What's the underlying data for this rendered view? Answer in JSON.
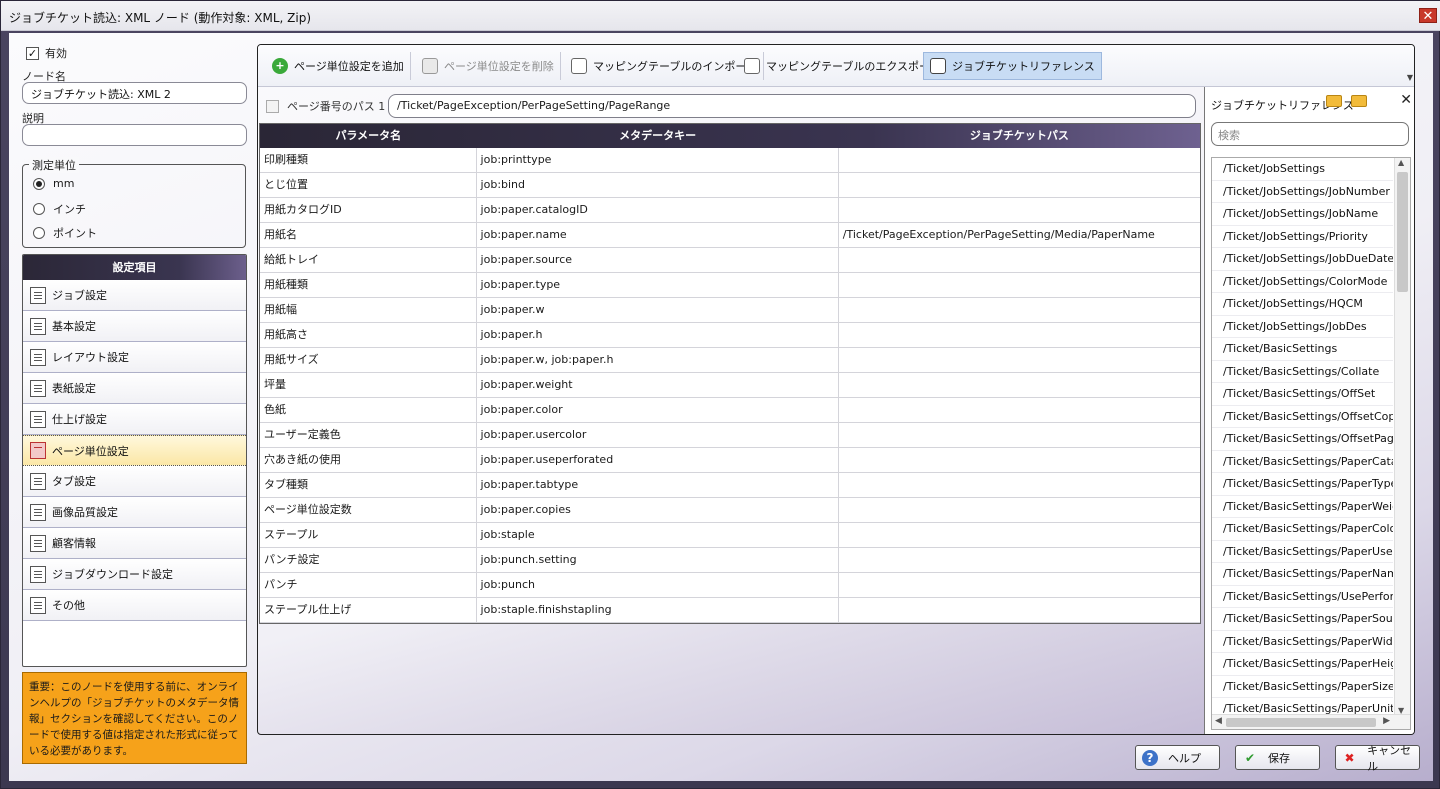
{
  "window": {
    "title": "ジョブチケット読込: XML ノード (動作対象: XML, Zip)",
    "close": "✕"
  },
  "left": {
    "enabled_label": "有効",
    "enabled_mark": "✓",
    "node_name_label": "ノード名",
    "node_name_value": "ジョブチケット読込: XML 2",
    "description_label": "説明",
    "description_value": "",
    "unit_legend": "測定単位",
    "units": [
      "mm",
      "インチ",
      "ポイント"
    ],
    "settings_header": "設定項目",
    "settings": [
      "ジョブ設定",
      "基本設定",
      "レイアウト設定",
      "表紙設定",
      "仕上げ設定",
      "ページ単位設定",
      "タブ設定",
      "画像品質設定",
      "顧客情報",
      "ジョブダウンロード設定",
      "その他"
    ],
    "notice": "重要：このノードを使用する前に、オンラインヘルプの「ジョブチケットのメタデータ情報」セクションを確認してください。このノードで使用する値は指定された形式に従っている必要があります。"
  },
  "toolbar": {
    "add": "ページ単位設定を追加",
    "delete": "ページ単位設定を削除",
    "import": "マッピングテーブルのインポート",
    "export": "マッピングテーブルのエクスポート",
    "reference": "ジョブチケットリファレンス"
  },
  "path": {
    "label": "ページ番号のパス 1",
    "value": "/Ticket/PageException/PerPageSetting/PageRange"
  },
  "grid": {
    "headers": [
      "パラメータ名",
      "メタデータキー",
      "ジョブチケットパス"
    ],
    "rows": [
      [
        "印刷種類",
        "job:printtype",
        ""
      ],
      [
        "とじ位置",
        "job:bind",
        ""
      ],
      [
        "用紙カタログID",
        "job:paper.catalogID",
        ""
      ],
      [
        "用紙名",
        "job:paper.name",
        "/Ticket/PageException/PerPageSetting/Media/PaperName"
      ],
      [
        "給紙トレイ",
        "job:paper.source",
        ""
      ],
      [
        "用紙種類",
        "job:paper.type",
        ""
      ],
      [
        "用紙幅",
        "job:paper.w",
        ""
      ],
      [
        "用紙高さ",
        "job:paper.h",
        ""
      ],
      [
        "用紙サイズ",
        "job:paper.w, job:paper.h",
        ""
      ],
      [
        "坪量",
        "job:paper.weight",
        ""
      ],
      [
        "色紙",
        "job:paper.color",
        ""
      ],
      [
        "ユーザー定義色",
        "job:paper.usercolor",
        ""
      ],
      [
        "穴あき紙の使用",
        "job:paper.useperforated",
        ""
      ],
      [
        "タブ種類",
        "job:paper.tabtype",
        ""
      ],
      [
        "ページ単位設定数",
        "job:paper.copies",
        ""
      ],
      [
        "ステープル",
        "job:staple",
        ""
      ],
      [
        "パンチ設定",
        "job:punch.setting",
        ""
      ],
      [
        "パンチ",
        "job:punch",
        ""
      ],
      [
        "ステープル仕上げ",
        "job:staple.finishstapling",
        ""
      ]
    ]
  },
  "reference": {
    "title": "ジョブチケットリファレンス",
    "close": "✕",
    "search_placeholder": "検索",
    "items": [
      "/Ticket/JobSettings",
      "/Ticket/JobSettings/JobNumber",
      "/Ticket/JobSettings/JobName",
      "/Ticket/JobSettings/Priority",
      "/Ticket/JobSettings/JobDueDate",
      "/Ticket/JobSettings/ColorMode",
      "/Ticket/JobSettings/HQCM",
      "/Ticket/JobSettings/JobDes",
      "/Ticket/BasicSettings",
      "/Ticket/BasicSettings/Collate",
      "/Ticket/BasicSettings/OffSet",
      "/Ticket/BasicSettings/OffsetCopies",
      "/Ticket/BasicSettings/OffsetPages",
      "/Ticket/BasicSettings/PaperCatalog",
      "/Ticket/BasicSettings/PaperType",
      "/Ticket/BasicSettings/PaperWeight",
      "/Ticket/BasicSettings/PaperColor",
      "/Ticket/BasicSettings/PaperUserColor",
      "/Ticket/BasicSettings/PaperName",
      "/Ticket/BasicSettings/UsePerforated",
      "/Ticket/BasicSettings/PaperSource",
      "/Ticket/BasicSettings/PaperWidth",
      "/Ticket/BasicSettings/PaperHeight",
      "/Ticket/BasicSettings/PaperSize",
      "/Ticket/BasicSettings/PaperUnit"
    ]
  },
  "footer": {
    "help": "ヘルプ",
    "save": "保存",
    "cancel": "キャンセル"
  }
}
